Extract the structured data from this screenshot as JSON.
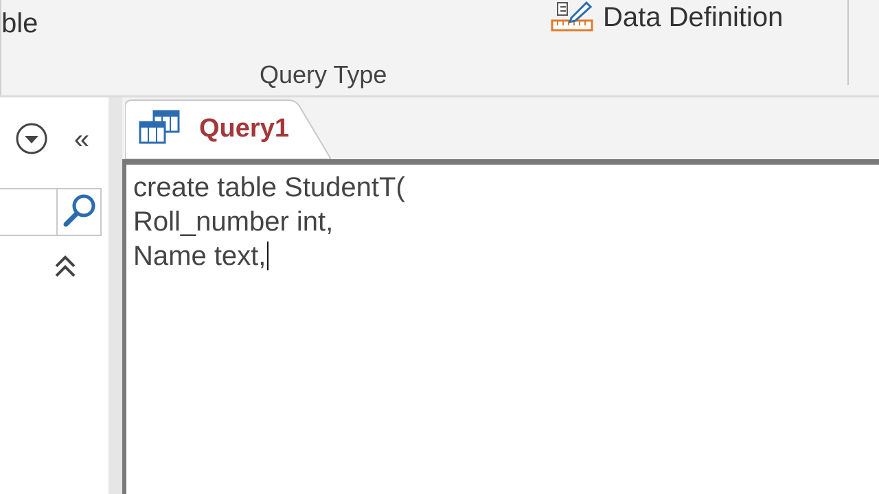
{
  "ribbon": {
    "partial_label": "ble",
    "data_definition_label": "Data Definition",
    "group_label": "Query Type",
    "accent_color": "#e07b2b"
  },
  "nav_pane": {
    "dropdown_icon": "chevron-down-circle-icon",
    "collapse_icon": "double-chevron-left-icon",
    "collapse_glyph": "«",
    "search_icon": "search-icon",
    "expand_icon": "double-chevron-up-icon"
  },
  "tab": {
    "label": "Query1",
    "icon": "query-icon",
    "label_color": "#a4373a"
  },
  "editor": {
    "lines": [
      "create table StudentT(",
      "Roll_number int,",
      "Name text,"
    ]
  }
}
